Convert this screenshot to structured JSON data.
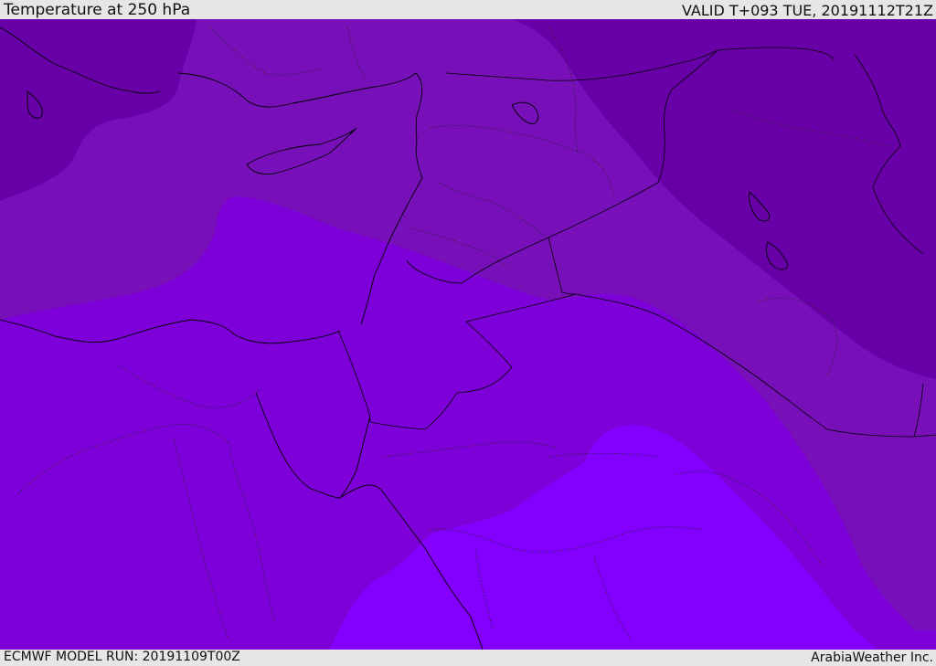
{
  "header": {
    "title": "Temperature at 250 hPa",
    "valid": "VALID T+093 TUE, 20191112T21Z"
  },
  "footer": {
    "model_run": "ECMWF MODEL RUN: 20191109T00Z",
    "credit": "ArabiaWeather Inc."
  },
  "colors": {
    "band_darkest": "#6800a8",
    "band_dark": "#7710b8",
    "band_mid": "#7e00d8",
    "band_light": "#8400fe"
  }
}
